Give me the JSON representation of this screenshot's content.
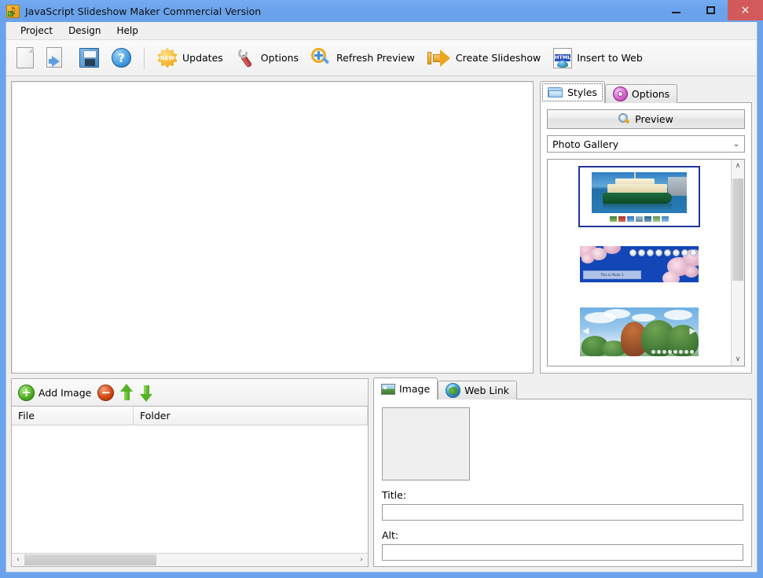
{
  "window": {
    "title": "JavaScript Slideshow Maker Commercial Version",
    "app_icon": "app-logo-icon",
    "accent_color": "#6aa3ec",
    "close_color": "#d25a5a",
    "buttons": {
      "minimize": "minimize-icon",
      "maximize": "maximize-icon",
      "close": "×"
    }
  },
  "menubar": {
    "items": [
      {
        "label": "Project"
      },
      {
        "label": "Design"
      },
      {
        "label": "Help"
      }
    ]
  },
  "toolbar": {
    "items": [
      {
        "label": "",
        "icon": "new-project-icon"
      },
      {
        "label": "",
        "icon": "open-project-icon"
      },
      {
        "label": "",
        "icon": "save-project-icon"
      },
      {
        "label": "",
        "icon": "help-icon"
      },
      {
        "label": "Updates",
        "icon": "updates-new-icon"
      },
      {
        "label": "Options",
        "icon": "options-wrench-icon"
      },
      {
        "label": "Refresh Preview",
        "icon": "refresh-preview-icon"
      },
      {
        "label": "Create Slideshow",
        "icon": "create-slideshow-arrow-icon"
      },
      {
        "label": "Insert to Web",
        "icon": "insert-to-web-html-icon"
      }
    ],
    "new_label": "NEW",
    "html_label": "HTML"
  },
  "styles_panel": {
    "tabs": [
      {
        "label": "Styles",
        "icon": "folder-icon",
        "active": true
      },
      {
        "label": "Options",
        "icon": "gear-icon",
        "active": false
      }
    ],
    "preview_button": "Preview",
    "preview_icon": "magnifier-icon",
    "gallery_select": {
      "value": "Photo Gallery",
      "chevron": "⌄",
      "options": [
        "Photo Gallery"
      ]
    },
    "style_items": [
      {
        "name": "ferry-thumbnail-style",
        "selected": true,
        "caption": ""
      },
      {
        "name": "blossom-thumbnail-style",
        "selected": false,
        "caption": "This is Photo 1"
      },
      {
        "name": "trees-thumbnail-style",
        "selected": false,
        "caption": ""
      }
    ],
    "scrollbar": {
      "up": "∧",
      "down": "∨"
    }
  },
  "file_panel": {
    "add_image_label": "Add Image",
    "buttons": [
      {
        "name": "add-image-button",
        "icon": "plus-icon"
      },
      {
        "name": "remove-image-button",
        "icon": "minus-icon"
      },
      {
        "name": "move-up-button",
        "icon": "arrow-up-icon"
      },
      {
        "name": "move-down-button",
        "icon": "arrow-down-icon"
      }
    ],
    "columns": [
      {
        "label": "File"
      },
      {
        "label": "Folder"
      }
    ],
    "rows": [],
    "scrollbar": {
      "left": "‹",
      "right": "›"
    }
  },
  "props_panel": {
    "tabs": [
      {
        "label": "Image",
        "icon": "image-icon",
        "active": true
      },
      {
        "label": "Web Link",
        "icon": "globe-icon",
        "active": false
      }
    ],
    "thumbnail_placeholder": "",
    "fields": [
      {
        "label": "Title:",
        "value": "",
        "placeholder": ""
      },
      {
        "label": "Alt:",
        "value": "",
        "placeholder": ""
      }
    ]
  }
}
